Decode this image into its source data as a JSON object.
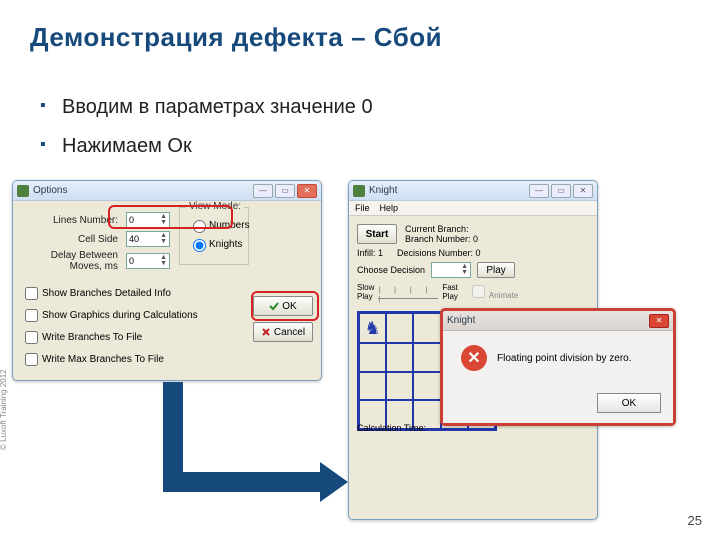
{
  "title": "Демонстрация дефекта – Сбой",
  "bullets": [
    "Вводим в параметрах значение 0",
    "Нажимаем Ок"
  ],
  "pagenum": "25",
  "copyright": "© Luxoft Training 2012",
  "options": {
    "title": "Options",
    "lines_label": "Lines Number:",
    "lines_value": "0",
    "cell_label": "Cell Side",
    "cell_value": "40",
    "delay_label": "Delay Between Moves, ms",
    "delay_value": "0",
    "chk1": "Show Branches Detailed Info",
    "chk2": "Show Graphics during Calculations",
    "chk3": "Write Branches To File",
    "chk4": "Write Max Branches To File",
    "view_mode": "View Mode:",
    "vm_numbers": "Numbers",
    "vm_knights": "Knights",
    "ok": "OK",
    "cancel": "Cancel"
  },
  "knight": {
    "title": "Knight",
    "file": "File",
    "help": "Help",
    "start": "Start",
    "current_branch": "Current Branch:",
    "branch_number": "Branch Number: 0",
    "infill": "Infill: 1",
    "decisions": "Decisions Number: 0",
    "choose": "Choose Decision",
    "play_btn": "Play",
    "slow": "Slow\nPlay",
    "fast": "Fast\nPlay",
    "animate": "Animate",
    "calc_time": "Calculation Time:"
  },
  "error": {
    "title": "Knight",
    "msg": "Floating point division by zero.",
    "ok": "OK"
  }
}
